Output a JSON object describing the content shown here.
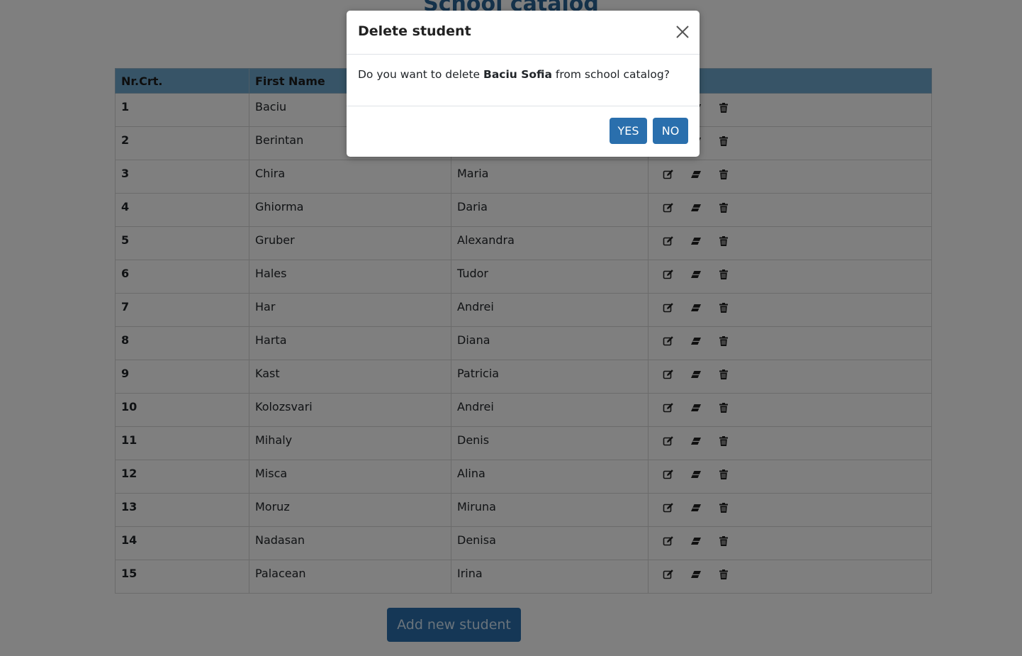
{
  "page": {
    "title": "School catalog"
  },
  "table": {
    "headers": {
      "nr": "Nr.Crt.",
      "first": "First Name",
      "last": "",
      "actions": ""
    },
    "rows": [
      {
        "nr": "1",
        "first": "Baciu",
        "last": "Sofia"
      },
      {
        "nr": "2",
        "first": "Berintan",
        "last": ""
      },
      {
        "nr": "3",
        "first": "Chira",
        "last": "Maria"
      },
      {
        "nr": "4",
        "first": "Ghiorma",
        "last": "Daria"
      },
      {
        "nr": "5",
        "first": "Gruber",
        "last": "Alexandra"
      },
      {
        "nr": "6",
        "first": "Hales",
        "last": "Tudor"
      },
      {
        "nr": "7",
        "first": "Har",
        "last": "Andrei"
      },
      {
        "nr": "8",
        "first": "Harta",
        "last": "Diana"
      },
      {
        "nr": "9",
        "first": "Kast",
        "last": "Patricia"
      },
      {
        "nr": "10",
        "first": "Kolozsvari",
        "last": "Andrei"
      },
      {
        "nr": "11",
        "first": "Mihaly",
        "last": "Denis"
      },
      {
        "nr": "12",
        "first": "Misca",
        "last": "Alina"
      },
      {
        "nr": "13",
        "first": "Moruz",
        "last": "Miruna"
      },
      {
        "nr": "14",
        "first": "Nadasan",
        "last": "Denisa"
      },
      {
        "nr": "15",
        "first": "Palacean",
        "last": "Irina"
      }
    ],
    "row_actions": [
      "edit-icon",
      "eraser-icon",
      "trash-icon"
    ]
  },
  "add_button": {
    "label": "Add new student"
  },
  "modal": {
    "title": "Delete student",
    "message_prefix": "Do you want to delete ",
    "student_name": "Baciu Sofia",
    "message_suffix": " from school catalog?",
    "yes_label": "YES",
    "no_label": "NO",
    "close_icon": "close-icon"
  },
  "colors": {
    "header_bg": "#6fa8cf",
    "button": "#2a6fad",
    "title": "#2a6496",
    "overlay": "rgba(0,0,0,0.5)"
  }
}
